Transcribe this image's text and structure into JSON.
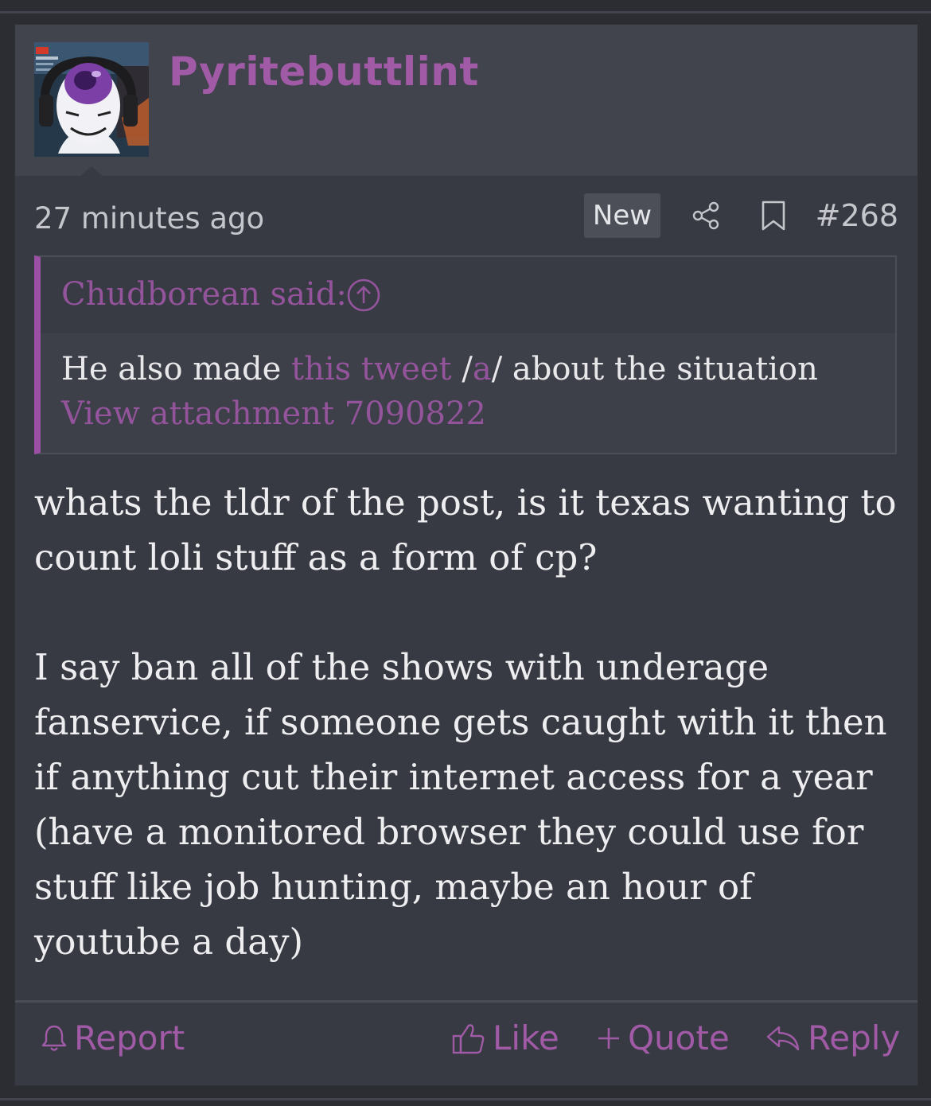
{
  "post": {
    "username": "Pyritebuttlint",
    "timestamp": "27 minutes ago",
    "badge": "New",
    "post_number": "#268",
    "quote": {
      "author": "Chudborean said:",
      "body_before": "He also made ",
      "body_link": "this tweet",
      "body_mid": " /",
      "body_link2": "a",
      "body_after": "/ about the situation",
      "attachment": "View attachment 7090822"
    },
    "message": {
      "paragraph1": "whats the tldr of the post, is it texas wanting to count loli stuff as a form of cp?",
      "paragraph2": "I say ban all of the shows with underage fanservice, if someone gets caught with it then if anything cut their internet access for a year (have a monitored browser they could use for stuff like job hunting, maybe an hour of youtube a day)"
    },
    "actions": {
      "report": "Report",
      "like": "Like",
      "quote": "Quote",
      "reply": "Reply"
    }
  },
  "colors": {
    "accent": "#a05aa6",
    "background": "#2b2d33",
    "card": "#373a42",
    "header": "#41444c"
  },
  "icons": [
    "share-icon",
    "bookmark-icon",
    "quote-arrow-icon",
    "bell-icon",
    "thumbs-up-icon",
    "plus-icon",
    "reply-icon"
  ]
}
